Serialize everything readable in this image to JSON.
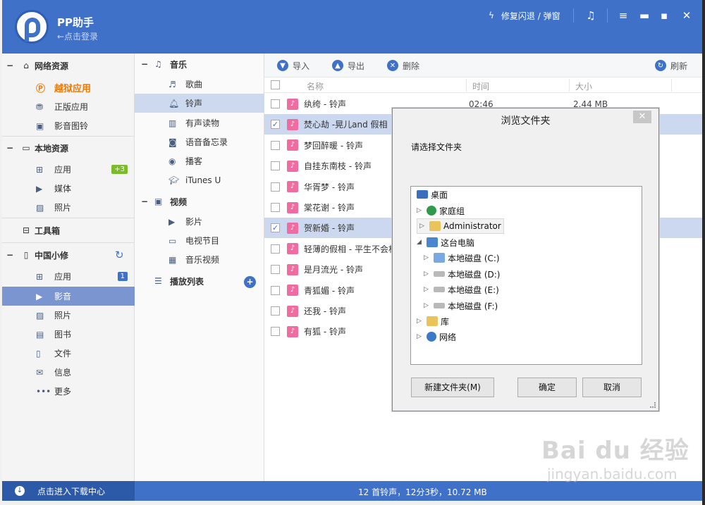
{
  "app": {
    "name": "PP助手",
    "login": "←点击登录"
  },
  "header": {
    "repair": "修复闪退 / 弹窗"
  },
  "sidebar": {
    "network": {
      "label": "网络资源",
      "items": [
        "越狱应用",
        "正版应用",
        "影音图铃"
      ]
    },
    "local": {
      "label": "本地资源",
      "items": [
        "应用",
        "媒体",
        "照片"
      ],
      "badge": "+3"
    },
    "toolbox": "工具箱",
    "device": {
      "label": "中国小修",
      "items": [
        "应用",
        "影音",
        "照片",
        "图书",
        "文件",
        "信息",
        "更多"
      ],
      "badge": "1"
    }
  },
  "midpanel": {
    "music": {
      "label": "音乐",
      "items": [
        "歌曲",
        "铃声",
        "有声读物",
        "语音备忘录",
        "播客",
        "iTunes U"
      ]
    },
    "video": {
      "label": "视频",
      "items": [
        "影片",
        "电视节目",
        "音乐视频"
      ]
    },
    "playlist": "播放列表"
  },
  "toolbar": {
    "import": "导入",
    "export": "导出",
    "delete": "删除",
    "refresh": "刷新"
  },
  "table": {
    "headers": {
      "name": "名称",
      "time": "时间",
      "size": "大小"
    },
    "rows": [
      {
        "title": "纨绔 - 铃声",
        "time": "02:46",
        "size": "2.44 MB",
        "checked": false
      },
      {
        "title": "焚心劫 -晃儿and 假相",
        "time": "",
        "size": "",
        "checked": true
      },
      {
        "title": "梦回醉暖 - 铃声",
        "time": "",
        "size": "",
        "checked": false
      },
      {
        "title": "自挂东南枝 - 铃声",
        "time": "",
        "size": "",
        "checked": false
      },
      {
        "title": "华胥梦 - 铃声",
        "time": "",
        "size": "",
        "checked": false
      },
      {
        "title": "棠花谢 - 铃声",
        "time": "",
        "size": "",
        "checked": false
      },
      {
        "title": "贺新婚 - 铃声",
        "time": "",
        "size": "",
        "checked": true
      },
      {
        "title": "轻薄的假相 - 平生不会相",
        "time": "",
        "size": "",
        "checked": false
      },
      {
        "title": "是月流光 - 铃声",
        "time": "",
        "size": "",
        "checked": false
      },
      {
        "title": "青狐媚 - 铃声",
        "time": "",
        "size": "",
        "checked": false
      },
      {
        "title": "还我 - 铃声",
        "time": "",
        "size": "",
        "checked": false
      },
      {
        "title": "有狐 - 铃声",
        "time": "",
        "size": "",
        "checked": false
      }
    ]
  },
  "statusbar": {
    "download": "点击进入下载中心",
    "summary": "12 首铃声，12分3秒，10.72 MB"
  },
  "dialog": {
    "title": "浏览文件夹",
    "prompt": "请选择文件夹",
    "tree": {
      "desktop": "桌面",
      "homegroup": "家庭组",
      "admin": "Administrator",
      "pc": "这台电脑",
      "drives": [
        "本地磁盘 (C:)",
        "本地磁盘 (D:)",
        "本地磁盘 (E:)",
        "本地磁盘 (F:)"
      ],
      "library": "库",
      "network": "网络"
    },
    "buttons": {
      "new_folder": "新建文件夹(M)",
      "ok": "确定",
      "cancel": "取消"
    }
  },
  "watermark": {
    "brand": "Bai du 经验",
    "url": "jingyan.baidu.com"
  }
}
